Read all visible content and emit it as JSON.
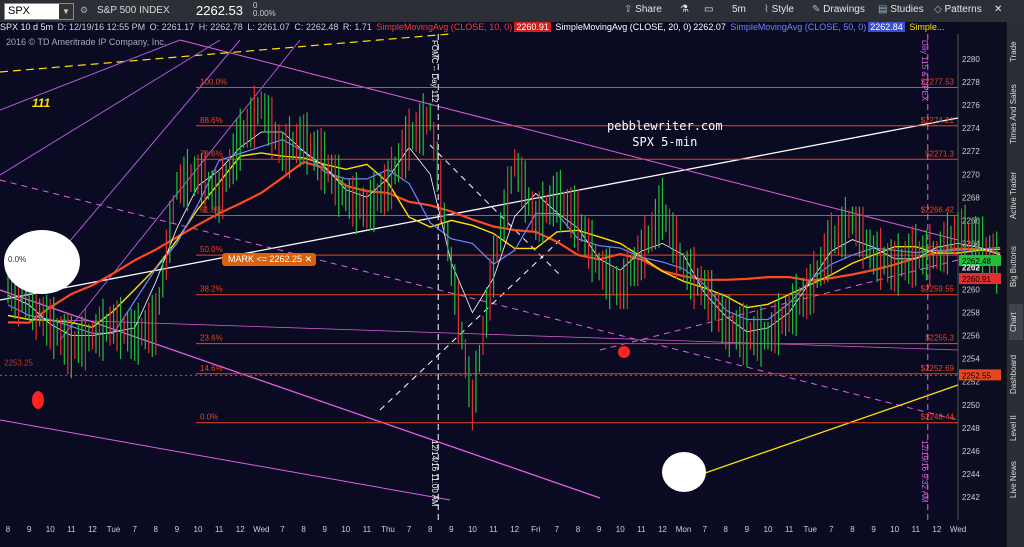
{
  "toolbar": {
    "symbol": "SPX",
    "chart_spec": "SPX 10 d 5m",
    "description": "S&P 500 INDEX",
    "price": "2262.53",
    "change": "0",
    "change_pct": "0.00%",
    "share_label": "Share",
    "timeframe_label": "5m",
    "style_label": "Style",
    "drawings_label": "Drawings",
    "studies_label": "Studies",
    "patterns_label": "Patterns"
  },
  "quote_line": {
    "date": "D: 12/19/16 12:55 PM",
    "open": "O: 2261.17",
    "high": "H: 2262.78",
    "low": "L: 2261.07",
    "close": "C: 2262.48",
    "range": "R: 1.71"
  },
  "studies": [
    {
      "label": "SimpleMovingAvg (CLOSE, 10, 0)",
      "value": "2260.91",
      "color": "#ff3b2f"
    },
    {
      "label": "SimpleMovingAvg (CLOSE, 20, 0)",
      "value": "2262.07",
      "color": "#ffffff"
    },
    {
      "label": "SimpleMovingAvg (CLOSE, 50, 0)",
      "value": "2262.84",
      "color": "#6f86ff"
    },
    {
      "label": "Simple...",
      "value": "",
      "color": "#ffe100"
    }
  ],
  "copyright": "2016 © TD Ameritrade IP Company, Inc.",
  "watermark": {
    "line1": "pebblewriter.com",
    "line2": "SPX 5-min"
  },
  "label_111": "111",
  "mark_label": "MARK <= 2262.25",
  "side_tabs": [
    "Trade",
    "Times And Sales",
    "Active Trader",
    "Big Buttons",
    "Chart",
    "Dashboard",
    "Level II",
    "Live News"
  ],
  "colors": {
    "background": "#0a0a23",
    "fib": "#e8461e",
    "magenta": "#e060e0",
    "price_up": "#22c03a",
    "price_down": "#e23030"
  },
  "chart_data": {
    "type": "line",
    "title": "SPX 10 d 5m",
    "xlabel": "",
    "ylabel": "",
    "ylim": [
      2240,
      2282
    ],
    "y_ticks": [
      2242,
      2244,
      2246,
      2248,
      2250,
      2252,
      2254,
      2256,
      2258,
      2260,
      2262,
      2264,
      2266,
      2268,
      2270,
      2272,
      2274,
      2276,
      2278,
      2280
    ],
    "x_tick_labels": [
      "8",
      "9",
      "10",
      "11",
      "12",
      "Tue",
      "7",
      "8",
      "9",
      "10",
      "11",
      "12",
      "Wed",
      "7",
      "8",
      "9",
      "10",
      "11",
      "Thu",
      "7",
      "8",
      "9",
      "10",
      "11",
      "12",
      "Fri",
      "7",
      "8",
      "9",
      "10",
      "11",
      "12",
      "Mon",
      "7",
      "8",
      "9",
      "10",
      "11",
      "Tue",
      "7",
      "8",
      "9",
      "10",
      "11",
      "12",
      "Wed"
    ],
    "fib_levels": [
      {
        "label": "100.0%",
        "value": 2277.53
      },
      {
        "label": "88.6%",
        "value": 2274.21
      },
      {
        "label": "78.6%",
        "value": 2271.3
      },
      {
        "label": "61.8%",
        "value": 2266.42
      },
      {
        "label": "50.0%",
        "value": 2262.98
      },
      {
        "label": "38.2%",
        "value": 2259.55
      },
      {
        "label": "23.6%",
        "value": 2255.3
      },
      {
        "label": "14.6%",
        "value": 2252.69
      },
      {
        "label": "0.0%",
        "value": 2248.44
      }
    ],
    "side_labels": [
      {
        "text": "2262.48",
        "value": 2262.48,
        "color": "#22c03a"
      },
      {
        "text": "2260.91",
        "value": 2260.91,
        "color": "#e23030"
      },
      {
        "text": "2262",
        "value": 2261.9,
        "color": "#ffffff"
      },
      {
        "text": "2252.55",
        "value": 2252.55,
        "color": "#e8461e"
      }
    ],
    "vlines": [
      {
        "label": "FOMC -- Day 112",
        "slot": 20
      },
      {
        "label": "12/14/16 11:00 AM",
        "slot": 20
      },
      {
        "label": "Day 115 & OPEX",
        "slot": 43
      },
      {
        "label": "12/19/16 9:32 AM",
        "slot": 43
      }
    ],
    "y_extra_label": "2253.25",
    "price_path": [
      [
        0,
        2260
      ],
      [
        1,
        2259
      ],
      [
        2,
        2257
      ],
      [
        3,
        2255
      ],
      [
        4,
        2256
      ],
      [
        5,
        2257
      ],
      [
        6,
        2256
      ],
      [
        7,
        2257
      ],
      [
        8,
        2269
      ],
      [
        9,
        2270
      ],
      [
        10,
        2268
      ],
      [
        11,
        2273
      ],
      [
        12,
        2276
      ],
      [
        13,
        2272
      ],
      [
        14,
        2273
      ],
      [
        15,
        2271
      ],
      [
        16,
        2268
      ],
      [
        17,
        2267
      ],
      [
        18,
        2269
      ],
      [
        19,
        2273
      ],
      [
        20,
        2275
      ],
      [
        21,
        2262
      ],
      [
        22,
        2250
      ],
      [
        23,
        2262
      ],
      [
        24,
        2271
      ],
      [
        25,
        2266
      ],
      [
        26,
        2268
      ],
      [
        27,
        2266
      ],
      [
        28,
        2262
      ],
      [
        29,
        2260
      ],
      [
        30,
        2263
      ],
      [
        31,
        2267
      ],
      [
        32,
        2262
      ],
      [
        33,
        2260
      ],
      [
        34,
        2257
      ],
      [
        35,
        2256
      ],
      [
        36,
        2256
      ],
      [
        37,
        2258
      ],
      [
        38,
        2260
      ],
      [
        39,
        2264
      ],
      [
        40,
        2266
      ],
      [
        41,
        2263
      ],
      [
        42,
        2262
      ],
      [
        43,
        2263
      ],
      [
        44,
        2263
      ],
      [
        45,
        2265
      ],
      [
        46,
        2264
      ],
      [
        47,
        2262
      ]
    ]
  }
}
